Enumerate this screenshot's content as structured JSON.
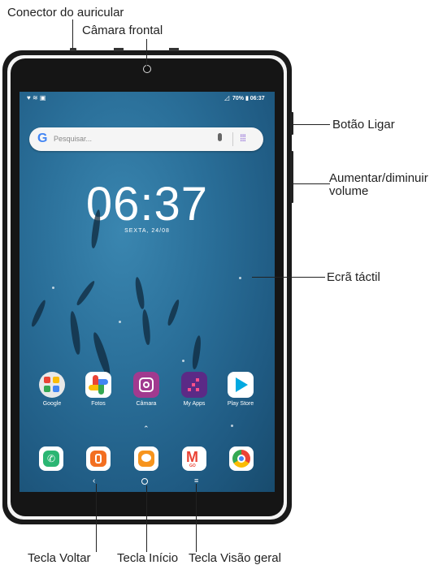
{
  "callouts": {
    "headset": "Conector do auricular",
    "front_camera": "Câmara frontal",
    "power": "Botão Ligar",
    "volume": "Aumentar/diminuir volume",
    "touchscreen": "Ecrã táctil",
    "back_key": "Tecla Voltar",
    "home_key": "Tecla Início",
    "overview_key": "Tecla Visão geral"
  },
  "screen": {
    "status_right": "70% ▮ 06:37",
    "search_placeholder": "Pesquisar...",
    "clock": "06:37",
    "date": "SEXTA, 24/08",
    "apps": [
      {
        "label": "Google",
        "icon": "google-folder-icon"
      },
      {
        "label": "Fotos",
        "icon": "photos-pinwheel-icon"
      },
      {
        "label": "Câmara",
        "icon": "camera-icon"
      },
      {
        "label": "My Apps",
        "icon": "my-apps-icon"
      },
      {
        "label": "Play Store",
        "icon": "play-store-icon"
      }
    ],
    "dock": [
      {
        "icon": "phone-icon",
        "color": "#2bb673"
      },
      {
        "icon": "contacts-icon",
        "color": "#f36f21"
      },
      {
        "icon": "messages-icon",
        "color": "#f7941d"
      },
      {
        "icon": "gmail-icon",
        "color": "#ffffff"
      },
      {
        "icon": "chrome-icon",
        "color": "#ffffff"
      }
    ]
  }
}
